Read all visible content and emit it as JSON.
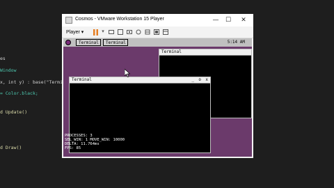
{
  "editor": {
    "lines": [
      {
        "text": "es",
        "color": "#d4d4d4"
      },
      {
        "text": " Window",
        "color": "#4ec9b0"
      },
      {
        "text": "x, int y) : base(\"Termin",
        "color": "#d4d4d4"
      },
      {
        "text": "= Color.black;",
        "color": "#4ec9b0"
      },
      {
        "text": "d Update()",
        "color": "#dcdcaa"
      },
      {
        "text": "d Draw()",
        "color": "#dcdcaa"
      }
    ]
  },
  "vm": {
    "title": "Cosmos - VMware Workstation 15 Player",
    "controls": {
      "minimize": "—",
      "maximize": "☐",
      "close": "✕"
    },
    "toolbar": {
      "player_menu": "Player ▾",
      "icons": [
        "pause-icon",
        "dropdown-icon",
        "send-keys-icon",
        "devices-icon",
        "snapshot-icon",
        "network-icon",
        "usb-icon",
        "fullscreen-icon",
        "unity-icon"
      ]
    },
    "guest": {
      "taskbar": {
        "buttons": [
          "Terminal",
          "Terminal"
        ],
        "clock": "5:14 AM"
      },
      "terminal_back": {
        "title": "Terminal"
      },
      "terminal_front": {
        "title": "Terminal",
        "controls": [
          "_",
          "o",
          "x"
        ]
      },
      "stats": [
        "PROCESSES: 3",
        "SEL_WIN: 1  MOVE_WIN: 10000",
        "DELTA: 11.764ms",
        "FPS: 85"
      ]
    }
  },
  "colors": {
    "guest_bg": "#6b3a6b",
    "pause": "#e67e22"
  }
}
